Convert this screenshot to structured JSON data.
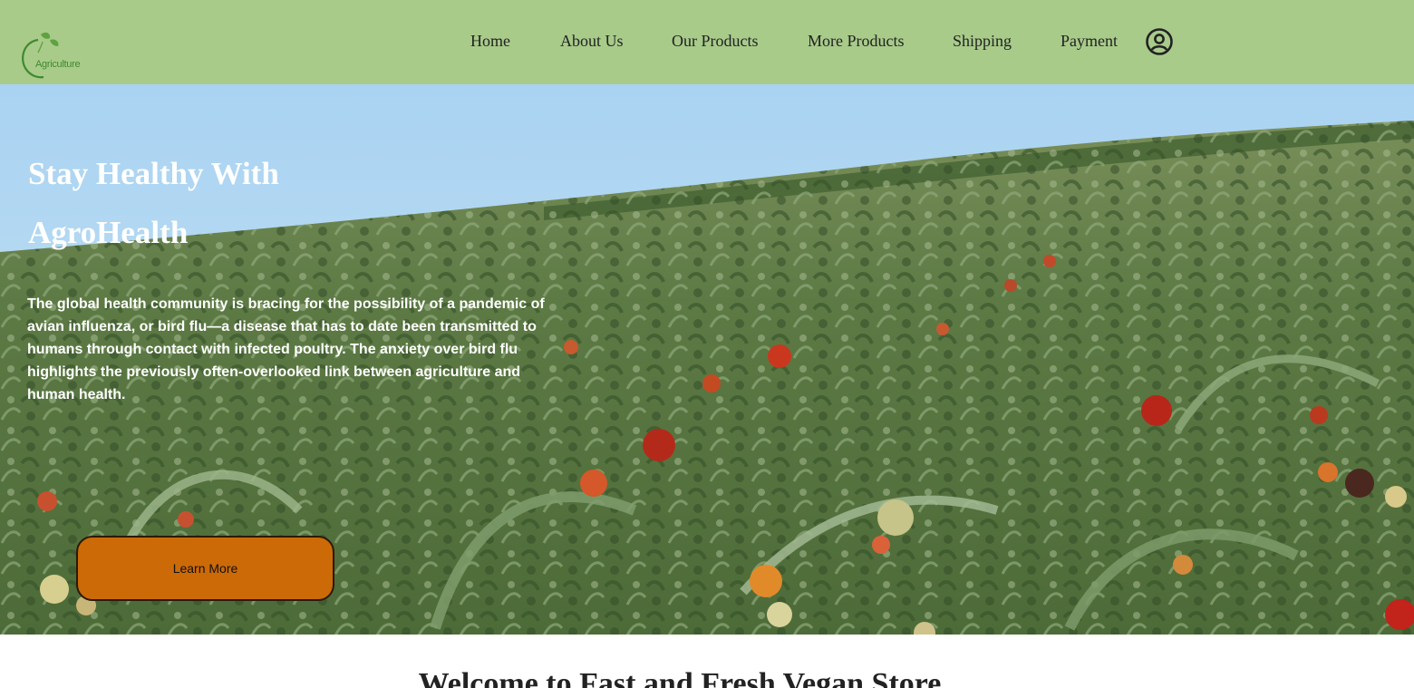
{
  "brand": {
    "logo_text": "Agriculture",
    "color": "#3f8a2f"
  },
  "nav": {
    "items": [
      {
        "label": "Home"
      },
      {
        "label": "About Us"
      },
      {
        "label": "Our Products"
      },
      {
        "label": "More Products"
      },
      {
        "label": "Shipping"
      },
      {
        "label": "Payment"
      }
    ],
    "account_icon": "user-circle-icon",
    "background": "#a8cb8a"
  },
  "hero": {
    "title_line1": "Stay Healthy With",
    "title_line2": "AgroHealth",
    "body": "The global health community is bracing for the possibility of a pandemic of avian influenza, or bird flu—a disease that has to date been transmitted to humans through contact with infected poultry. The anxiety over bird flu highlights the previously often-overlooked link between agriculture and human health.",
    "cta_label": "Learn More",
    "cta_color": "#cc6a07"
  },
  "welcome": {
    "heading": "Welcome to Fast and Fresh Vegan Store"
  }
}
